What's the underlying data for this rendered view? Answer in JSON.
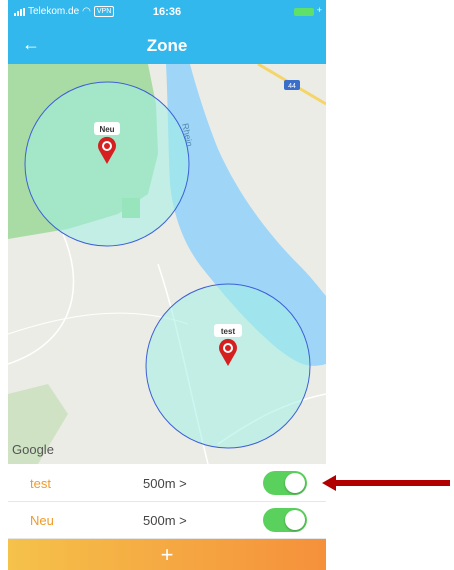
{
  "statusbar": {
    "carrier": "Telekom.de",
    "vpn": "VPN",
    "time": "16:36"
  },
  "navbar": {
    "title": "Zone",
    "back_icon": "←"
  },
  "map": {
    "google_label": "Google",
    "river_label": "Rhein",
    "road_badge": "44",
    "markers": [
      {
        "label": "Neu"
      },
      {
        "label": "test"
      }
    ]
  },
  "zones": [
    {
      "name": "test",
      "radius": "500m  >",
      "enabled": true
    },
    {
      "name": "Neu",
      "radius": "500m  >",
      "enabled": true
    }
  ],
  "add_button": {
    "label": "+"
  },
  "colors": {
    "header": "#33b8ee",
    "accent": "#ef9b2c",
    "toggle": "#5bd15d",
    "arrow": "#b20000"
  }
}
